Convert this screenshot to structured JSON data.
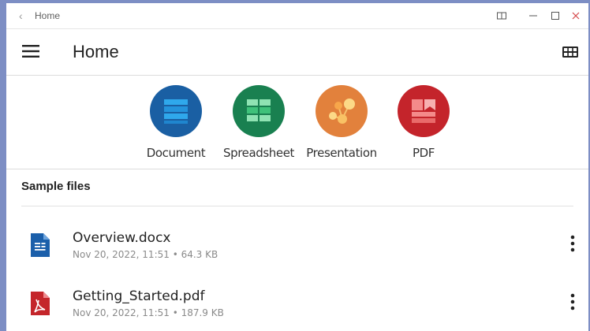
{
  "window": {
    "title": "Home",
    "controls": [
      "split-view",
      "minimize",
      "maximize",
      "close"
    ]
  },
  "appbar": {
    "title": "Home",
    "menu_icon": "hamburger-menu-icon",
    "view_icon": "grid-view-icon"
  },
  "create": {
    "items": [
      {
        "label": "Document",
        "color": "#1a5fa3",
        "icon": "document-icon"
      },
      {
        "label": "Spreadsheet",
        "color": "#198050",
        "icon": "spreadsheet-icon"
      },
      {
        "label": "Presentation",
        "color": "#e2813c",
        "icon": "presentation-icon"
      },
      {
        "label": "PDF",
        "color": "#c4242b",
        "icon": "pdf-icon"
      }
    ]
  },
  "sample_files": {
    "title": "Sample files",
    "items": [
      {
        "name": "Overview.docx",
        "date": "Nov 20, 2022, 11:51",
        "size": "64.3 KB",
        "meta": "Nov 20, 2022, 11:51 • 64.3 KB",
        "icon": "docx-file-icon",
        "color": "#1b5faa"
      },
      {
        "name": "Getting_Started.pdf",
        "date": "Nov 20, 2022, 11:51",
        "size": "187.9 KB",
        "meta": "Nov 20, 2022, 11:51 • 187.9 KB",
        "icon": "pdf-file-icon",
        "color": "#c4262b"
      }
    ]
  }
}
